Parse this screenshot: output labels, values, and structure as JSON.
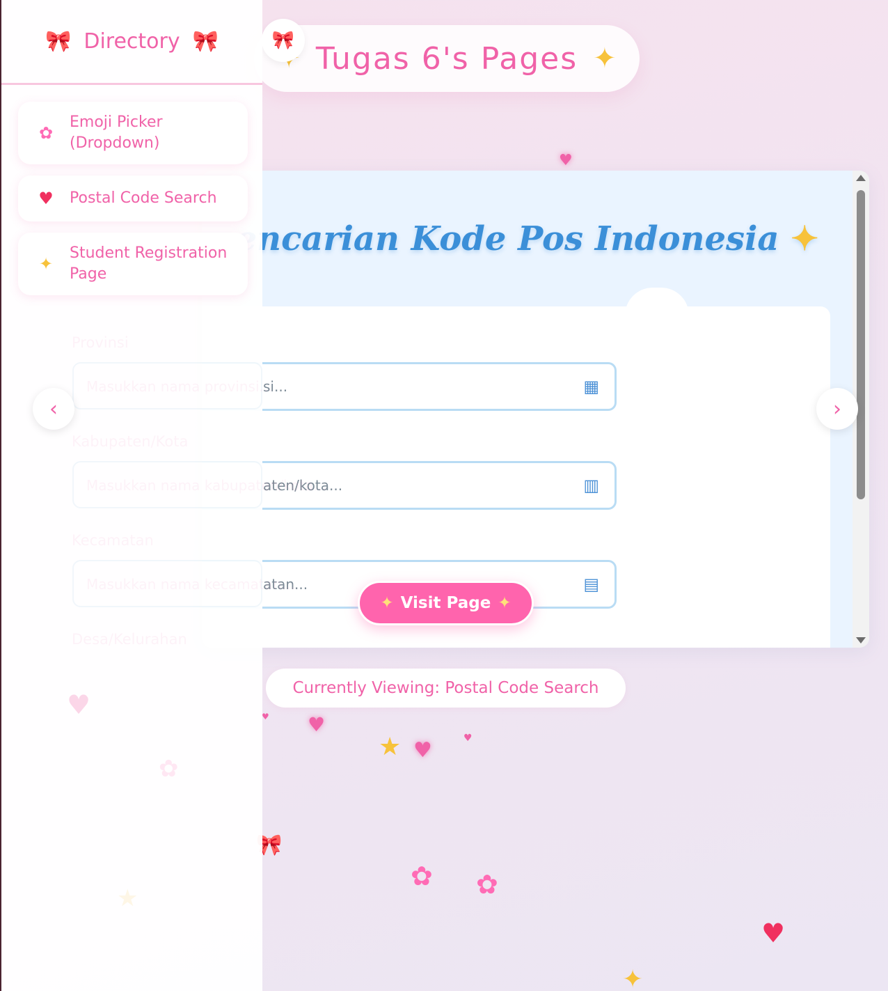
{
  "header": {
    "title": "Tugas 6's Pages",
    "sparkle_icon": "sparkles-icon",
    "bow_icon": "ribbon-bow-icon"
  },
  "sidebar": {
    "title": "Directory",
    "items": [
      {
        "label_line1": "Emoji Picker",
        "label_line2": "(Dropdown)",
        "icon": "cherry-blossom-icon"
      },
      {
        "label_line1": "Postal Code Search",
        "label_line2": "",
        "icon": "sparkling-heart-icon"
      },
      {
        "label_line1": "Student Registration",
        "label_line2": "Page",
        "icon": "sparkles-icon"
      }
    ]
  },
  "preview": {
    "title": "Pencarian Kode Pos Indonesia",
    "title_visible": "encarian Kode Pos Indonesia",
    "fields": [
      {
        "label": "Provinsi",
        "placeholder": "Masukkan nama provinsi...",
        "visible_tail": "si...",
        "icon": "map-icon"
      },
      {
        "label": "Kabupaten/Kota",
        "placeholder": "Masukkan nama kabupaten/kota...",
        "visible_tail": "aten/kota...",
        "icon": "city-icon"
      },
      {
        "label": "Kecamatan",
        "placeholder": "Masukkan nama kecamatan...",
        "visible_tail": "atan...",
        "icon": "building-icon"
      },
      {
        "label": "Desa/Kelurahan"
      }
    ]
  },
  "visit_button": {
    "label": "Visit Page"
  },
  "currently_viewing": "Currently Viewing: Postal Code Search",
  "arrows": {
    "prev": "‹",
    "next": "›"
  },
  "colors": {
    "accent_pink": "#f062a8",
    "button_pink": "#ff64ad",
    "title_blue": "#3b8fd8",
    "field_border": "#b9dcf4",
    "sparkle_gold": "#f7c23b"
  }
}
